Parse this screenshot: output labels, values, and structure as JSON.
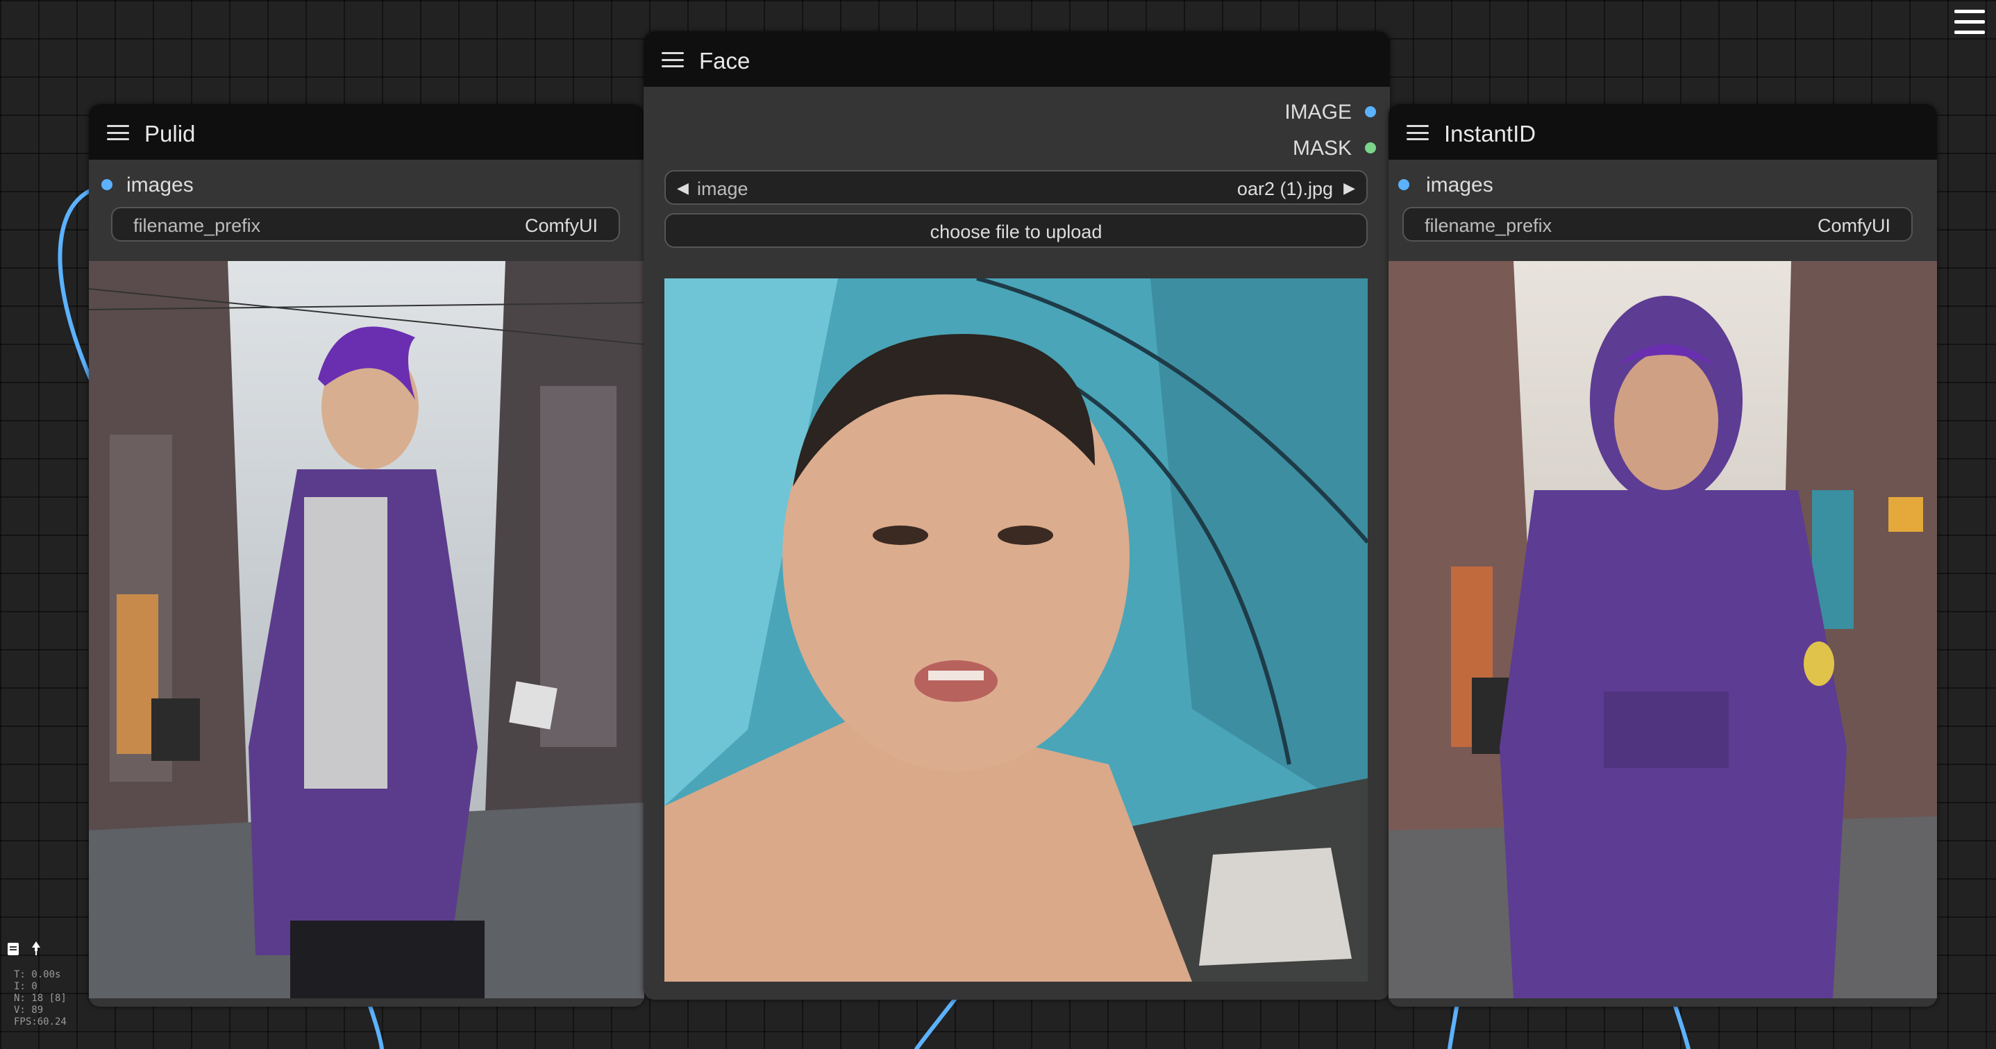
{
  "nodes": {
    "pulid": {
      "title": "Pulid",
      "input_label": "images",
      "widget_label": "filename_prefix",
      "widget_value": "ComfyUI"
    },
    "face": {
      "title": "Face",
      "outputs": [
        "IMAGE",
        "MASK"
      ],
      "image_label": "image",
      "image_value": "oar2 (1).jpg",
      "upload_label": "choose file to upload"
    },
    "instantid": {
      "title": "InstantID",
      "input_label": "images",
      "widget_label": "filename_prefix",
      "widget_value": "ComfyUI"
    }
  },
  "stats": {
    "t": "T: 0.00s",
    "i": "I: 0",
    "n": "N: 18 [8]",
    "v": "V: 89",
    "fps": "FPS:60.24"
  },
  "colors": {
    "canvas": "#222222",
    "node_body": "#353535",
    "node_header": "#0f0f0f",
    "image_slot": "#5cb2ff",
    "mask_slot": "#7bd48a",
    "link": "#5cb2ff"
  },
  "icons": [
    "node-menu-icon",
    "main-menu-icon",
    "arrow-left-icon",
    "arrow-right-icon",
    "document-icon",
    "pin-icon"
  ]
}
